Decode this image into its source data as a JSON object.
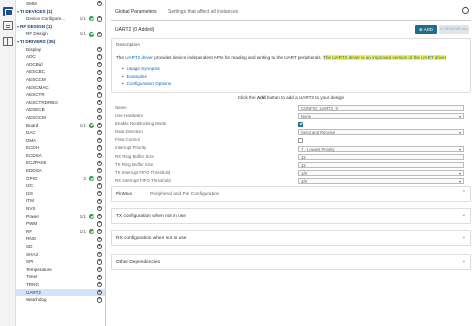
{
  "tree": [
    {
      "label": "SMM",
      "type": "item",
      "count": "",
      "checked": false,
      "selected": false
    },
    {
      "label": "TI DEVICES (1)",
      "type": "head",
      "count": "",
      "checked": false,
      "selected": false
    },
    {
      "label": "Device Configure...",
      "type": "item",
      "count": "1/1",
      "checked": true,
      "selected": false
    },
    {
      "label": "RF DESIGN (1)",
      "type": "head",
      "count": "",
      "checked": false,
      "selected": false
    },
    {
      "label": "RF Design",
      "type": "item",
      "count": "1/1",
      "checked": true,
      "selected": false
    },
    {
      "label": "TI DRIVERS (35)",
      "type": "head",
      "count": "",
      "checked": false,
      "selected": false
    },
    {
      "label": "Display",
      "type": "item",
      "count": "",
      "checked": false,
      "selected": false
    },
    {
      "label": "ADC",
      "type": "item",
      "count": "",
      "checked": false,
      "selected": false
    },
    {
      "label": "ADCBuf",
      "type": "item",
      "count": "",
      "checked": false,
      "selected": false
    },
    {
      "label": "AESCBC",
      "type": "item",
      "count": "",
      "checked": false,
      "selected": false
    },
    {
      "label": "AESCCM",
      "type": "item",
      "count": "",
      "checked": false,
      "selected": false
    },
    {
      "label": "AESCMAC",
      "type": "item",
      "count": "",
      "checked": false,
      "selected": false
    },
    {
      "label": "AESCTR",
      "type": "item",
      "count": "",
      "checked": false,
      "selected": false
    },
    {
      "label": "AESCTRDRBG",
      "type": "item",
      "count": "",
      "checked": false,
      "selected": false
    },
    {
      "label": "AESECB",
      "type": "item",
      "count": "",
      "checked": false,
      "selected": false
    },
    {
      "label": "AESGCM",
      "type": "item",
      "count": "",
      "checked": false,
      "selected": false
    },
    {
      "label": "Board",
      "type": "item",
      "count": "1/1",
      "checked": true,
      "selected": false
    },
    {
      "label": "DAC",
      "type": "item",
      "count": "",
      "checked": false,
      "selected": false
    },
    {
      "label": "DMA",
      "type": "item",
      "count": "",
      "checked": false,
      "selected": false
    },
    {
      "label": "ECDH",
      "type": "item",
      "count": "",
      "checked": false,
      "selected": false
    },
    {
      "label": "ECDSA",
      "type": "item",
      "count": "",
      "checked": false,
      "selected": false
    },
    {
      "label": "ECJPAKE",
      "type": "item",
      "count": "",
      "checked": false,
      "selected": false
    },
    {
      "label": "EDDSA",
      "type": "item",
      "count": "",
      "checked": false,
      "selected": false
    },
    {
      "label": "GPIO",
      "type": "item",
      "count": "2",
      "checked": true,
      "selected": false
    },
    {
      "label": "I2C",
      "type": "item",
      "count": "",
      "checked": false,
      "selected": false
    },
    {
      "label": "I2S",
      "type": "item",
      "count": "",
      "checked": false,
      "selected": false
    },
    {
      "label": "ITM",
      "type": "item",
      "count": "",
      "checked": false,
      "selected": false
    },
    {
      "label": "NVS",
      "type": "item",
      "count": "",
      "checked": false,
      "selected": false
    },
    {
      "label": "Power",
      "type": "item",
      "count": "1/1",
      "checked": true,
      "selected": false
    },
    {
      "label": "PWM",
      "type": "item",
      "count": "",
      "checked": false,
      "selected": false
    },
    {
      "label": "RF",
      "type": "item",
      "count": "1/1",
      "checked": true,
      "selected": false
    },
    {
      "label": "RNG",
      "type": "item",
      "count": "",
      "checked": false,
      "selected": false
    },
    {
      "label": "SD",
      "type": "item",
      "count": "",
      "checked": false,
      "selected": false
    },
    {
      "label": "SHA2",
      "type": "item",
      "count": "",
      "checked": false,
      "selected": false
    },
    {
      "label": "SPI",
      "type": "item",
      "count": "",
      "checked": false,
      "selected": false
    },
    {
      "label": "Temperature",
      "type": "item",
      "count": "",
      "checked": false,
      "selected": false
    },
    {
      "label": "Timer",
      "type": "item",
      "count": "",
      "checked": false,
      "selected": false
    },
    {
      "label": "TRNG",
      "type": "item",
      "count": "",
      "checked": false,
      "selected": false
    },
    {
      "label": "UART2",
      "type": "item",
      "count": "",
      "checked": false,
      "selected": true
    },
    {
      "label": "Watchdog",
      "type": "item",
      "count": "",
      "checked": false,
      "selected": false
    }
  ],
  "global": {
    "title": "Global Parameters",
    "subtitle": "Settings that affect all instances"
  },
  "instance": {
    "title": "UART2 (0 Added)",
    "add_label": "ADD",
    "remove_label": "REMOVE ALL"
  },
  "description": {
    "heading": "Description",
    "pre": "The ",
    "link": "UART2 driver",
    "mid": " provides device independent APIs for reading and writing to the UART peripherals. ",
    "highlight": "The UART2 driver is an improved version of the UART driver",
    "links": [
      "Usage Synopsis",
      "Examples",
      "Configuration Options"
    ]
  },
  "click_msg": {
    "pre": "Click the ",
    "bold": "Add",
    "post": " button to add a UART2 to your design"
  },
  "properties": [
    {
      "label": "Name",
      "kind": "text",
      "value": "CONFIG_UART2_0"
    },
    {
      "label": "Use Hardware",
      "kind": "select",
      "value": "None"
    },
    {
      "label": "Enable Nonblocking Mode",
      "kind": "check",
      "value": true
    },
    {
      "label": "Data Direction",
      "kind": "select",
      "value": "Send and Receive"
    },
    {
      "label": "Flow Control",
      "kind": "check",
      "value": false
    },
    {
      "label": "Interrupt Priority",
      "kind": "select",
      "value": "7 - Lowest Priority"
    },
    {
      "label": "RX Ring Buffer Size",
      "kind": "text",
      "value": "32"
    },
    {
      "label": "TX Ring Buffer Size",
      "kind": "text",
      "value": "32"
    },
    {
      "label": "TX Interrupt FIFO Threshold",
      "kind": "select",
      "value": "1/8"
    },
    {
      "label": "RX Interrupt FIFO Threshold",
      "kind": "select",
      "value": "4/8"
    }
  ],
  "sections": [
    {
      "title": "PinMux",
      "subtitle": "Peripheral and Pin Configuration"
    },
    {
      "title": "TX configuration when not in use",
      "subtitle": ""
    },
    {
      "title": "RX configuration when not in use",
      "subtitle": ""
    },
    {
      "title": "Other Dependencies",
      "subtitle": ""
    }
  ],
  "colors": {
    "accent": "#1f6f8b",
    "check_green": "#2e9e3d",
    "link": "#1565c0",
    "highlight": "#fff33a"
  }
}
